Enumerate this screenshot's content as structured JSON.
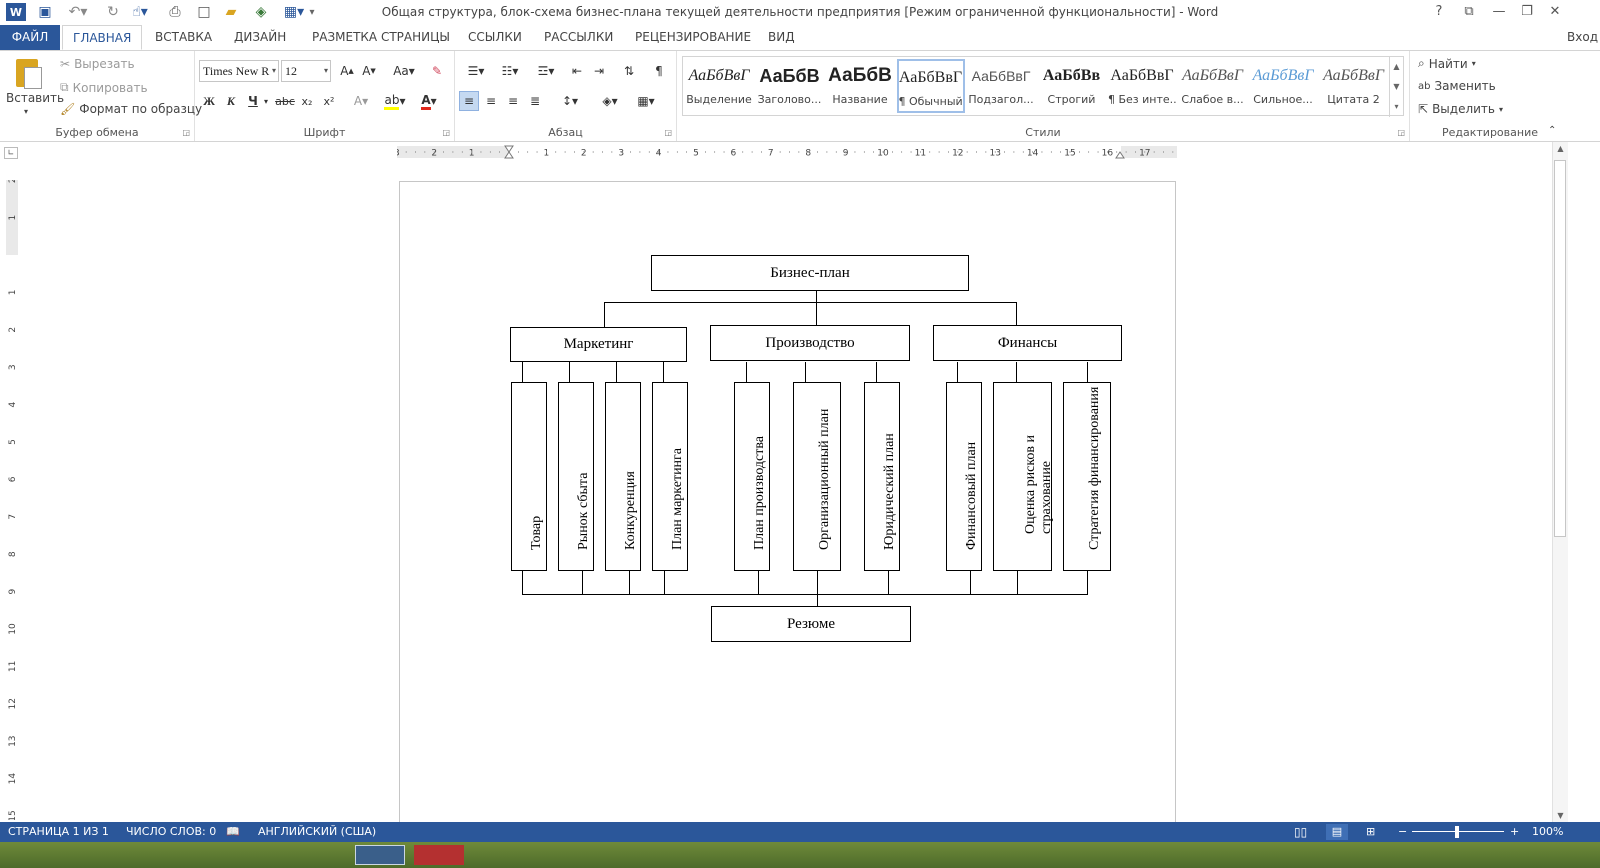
{
  "window": {
    "title": "Общая структура, блок-схема бизнес-плана текущей деятельности предприятия [Режим ограниченной функциональности] - Word",
    "help": "?",
    "signin": "Вход"
  },
  "tabs": {
    "file": "ФАЙЛ",
    "home": "ГЛАВНАЯ",
    "insert": "ВСТАВКА",
    "design": "ДИЗАЙН",
    "layout": "РАЗМЕТКА СТРАНИЦЫ",
    "references": "ССЫЛКИ",
    "mailings": "РАССЫЛКИ",
    "review": "РЕЦЕНЗИРОВАНИЕ",
    "view": "ВИД"
  },
  "clipboard": {
    "paste": "Вставить",
    "cut": "Вырезать",
    "copy": "Копировать",
    "format_painter": "Формат по образцу",
    "label": "Буфер обмена"
  },
  "font": {
    "name": "Times New R",
    "size": "12",
    "bold": "Ж",
    "italic": "К",
    "underline": "Ч",
    "strike": "abc",
    "label": "Шрифт"
  },
  "paragraph": {
    "label": "Абзац",
    "pilcrow": "¶"
  },
  "styles": {
    "label": "Стили",
    "items": [
      {
        "preview": "АаБбВвГ",
        "name": "Выделение"
      },
      {
        "preview": "АаБбВ",
        "name": "Заголово..."
      },
      {
        "preview": "АаБбВ",
        "name": "Название"
      },
      {
        "preview": "АаБбВвГ",
        "name": "¶ Обычный"
      },
      {
        "preview": "АаБбВвГ",
        "name": "Подзагол..."
      },
      {
        "preview": "АаБбВв",
        "name": "Строгий"
      },
      {
        "preview": "АаБбВвГ",
        "name": "¶ Без инте..."
      },
      {
        "preview": "АаБбВвГ",
        "name": "Слабое в..."
      },
      {
        "preview": "АаБбВвГ",
        "name": "Сильное..."
      },
      {
        "preview": "АаБбВвГ",
        "name": "Цитата 2"
      }
    ]
  },
  "editing": {
    "find": "Найти",
    "replace": "Заменить",
    "select": "Выделить",
    "label": "Редактирование"
  },
  "ruler": {
    "h_ticks": [
      "3",
      "2",
      "1",
      "1",
      "2",
      "3",
      "4",
      "5",
      "6",
      "7",
      "8",
      "9",
      "10",
      "11",
      "12",
      "13",
      "14",
      "15",
      "16",
      "17"
    ],
    "v_ticks": [
      "2",
      "1",
      "1",
      "2",
      "3",
      "4",
      "5",
      "6",
      "7",
      "8",
      "9",
      "10",
      "11",
      "12",
      "13",
      "14",
      "15"
    ]
  },
  "diagram": {
    "root": "Бизнес-план",
    "marketing": "Маркетинг",
    "production": "Производство",
    "finance": "Финансы",
    "m_items": [
      "Товар",
      "Рынок сбыта",
      "Конкуренция",
      "План маркетинга"
    ],
    "p_items": [
      "План производства",
      "Организационный план",
      "Юридический план"
    ],
    "f_items": [
      "Финансовый план",
      "Оценка рисков и страхование",
      "Стратегия финансирования"
    ],
    "summary": "Резюме"
  },
  "status": {
    "page": "СТРАНИЦА 1 ИЗ 1",
    "words": "ЧИСЛО СЛОВ: 0",
    "language": "АНГЛИЙСКИЙ (США)",
    "zoom": "100%"
  }
}
